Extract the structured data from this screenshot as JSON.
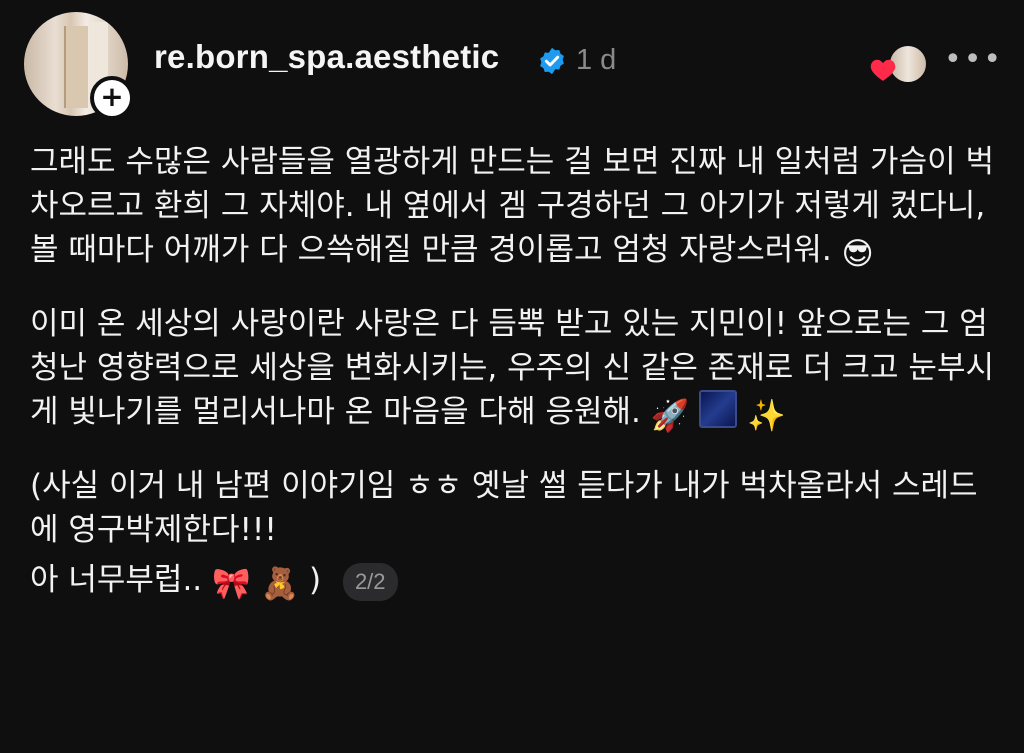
{
  "post": {
    "username": "re.born_spa.aesthetic",
    "time": "1 d",
    "follow_symbol": "+",
    "more_symbol": "•••",
    "paragraphs": [
      "그래도 수많은 사람들을 열광하게 만드는 걸 보면 진짜 내 일처럼 가슴이 벅차오르고 환희 그 자체야. 내 옆에서 겜 구경하던 그 아기가 저렇게 컸다니, 볼 때마다 어깨가 다 으쓱해질 만큼 경이롭고 엄청 자랑스러워.",
      "이미 온 세상의 사랑이란 사랑은 다 듬뿍 받고 있는 지민이! 앞으로는 그 엄청난 영향력으로 세상을 변화시키는, 우주의 신 같은 존재로 더 크고 눈부시게 빛나기를 멀리서나마 온 마음을 다해 응원해.",
      "(사실 이거 내 남편 이야기임 ㅎㅎ 옛날 썰 듣다가 내가 벅차올라서 스레드에 영구박제한다!!!",
      "아 너무부럽.."
    ],
    "emojis": {
      "p1": "😎",
      "p2_rocket": "🚀",
      "p2_sparkles": "✨",
      "p4_bow": "🎀",
      "p4_bear": "🧸",
      "p4_close": ")"
    },
    "page_indicator": "2/2"
  },
  "colors": {
    "background": "#0f0f10",
    "text": "#f2f2f2",
    "muted": "#8a8a8a",
    "verified": "#1d9bf0",
    "heart": "#ff2a4a"
  },
  "icons": [
    "verified-badge-icon",
    "heart-icon",
    "more-icon",
    "plus-icon"
  ]
}
